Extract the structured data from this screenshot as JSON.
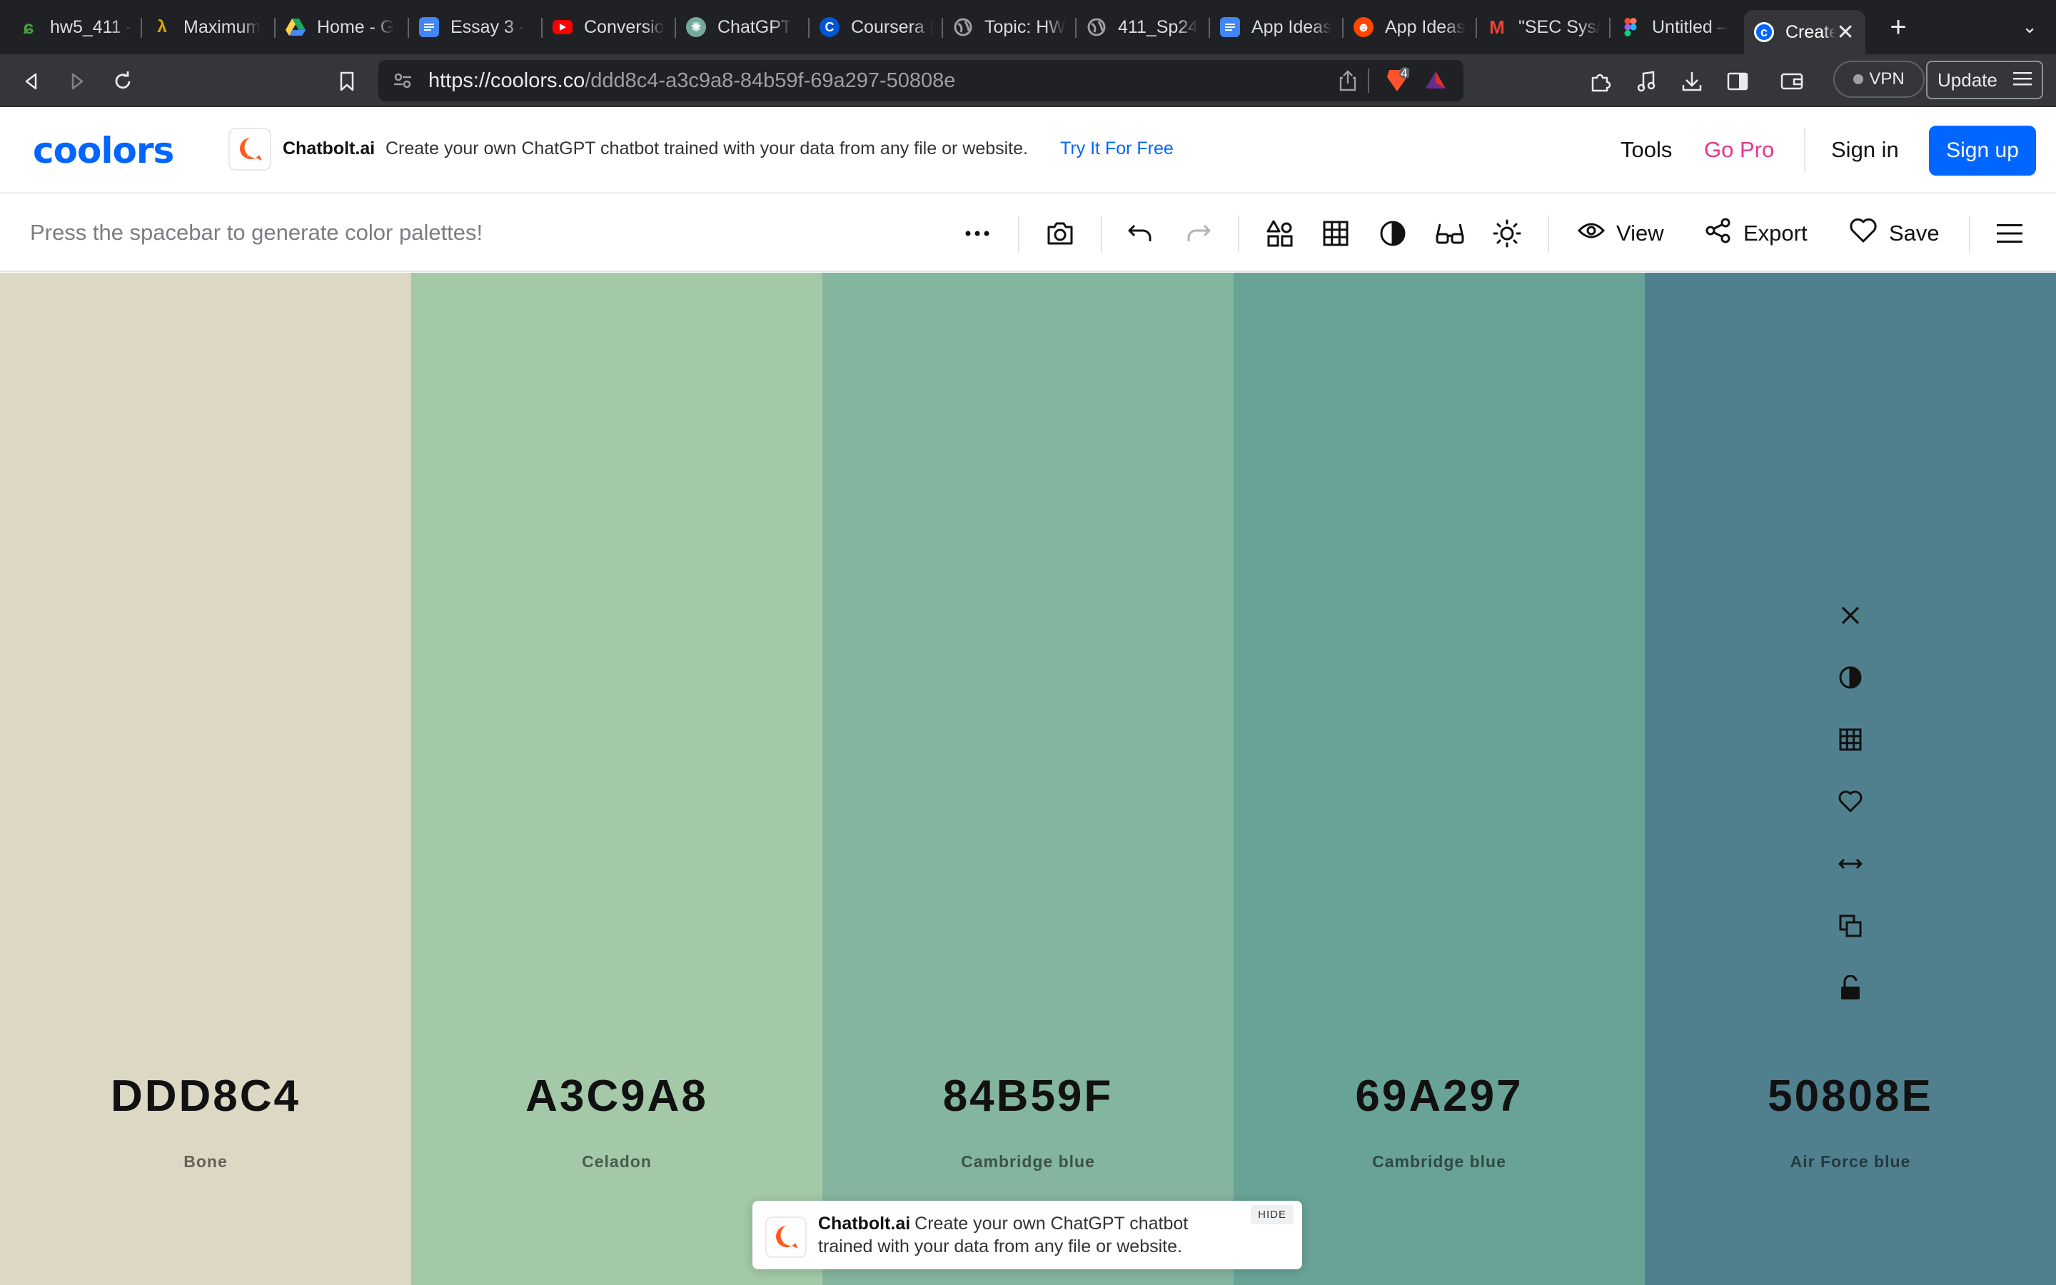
{
  "browser": {
    "tabs": [
      {
        "label": "hw5_411 -",
        "icon": "overleaf-icon",
        "color": "#47a141"
      },
      {
        "label": "Maximum",
        "icon": "python-icon",
        "color": "#e0a800"
      },
      {
        "label": "Home - G",
        "icon": "google-drive-icon",
        "color": "#1fa463"
      },
      {
        "label": "Essay 3 -",
        "icon": "google-docs-icon",
        "color": "#4285f4"
      },
      {
        "label": "Conversio",
        "icon": "youtube-icon",
        "color": "#ff0000"
      },
      {
        "label": "ChatGPT",
        "icon": "chatgpt-icon",
        "color": "#74aa9c"
      },
      {
        "label": "Coursera |",
        "icon": "coursera-icon",
        "color": "#0056d2"
      },
      {
        "label": "Topic: HW",
        "icon": "globe-icon",
        "color": "#9aa0a6"
      },
      {
        "label": "411_Sp24",
        "icon": "globe-icon",
        "color": "#9aa0a6"
      },
      {
        "label": "App Ideas",
        "icon": "google-docs-icon",
        "color": "#4285f4"
      },
      {
        "label": "App Ideas",
        "icon": "reddit-icon",
        "color": "#ff4500"
      },
      {
        "label": "\"SEC Sys/",
        "icon": "gmail-icon",
        "color": "#ea4335"
      },
      {
        "label": "Untitled –",
        "icon": "figma-icon",
        "color": "#a259ff"
      }
    ],
    "active_tab": {
      "label": "Create",
      "icon": "coolors-icon",
      "color": "#0066ff"
    },
    "url_host": "https://coolors.co",
    "url_path": "/ddd8c4-a3c9a8-84b59f-69a297-50808e",
    "brave_badge": "4",
    "vpn_label": "VPN",
    "update_label": "Update"
  },
  "site": {
    "logo": "coolors",
    "ad": {
      "brand": "Chatbolt.ai",
      "text": "Create your own ChatGPT chatbot trained with your data from any file or website.",
      "link": "Try It For Free"
    },
    "nav": {
      "tools": "Tools",
      "gopro": "Go Pro",
      "signin": "Sign in",
      "signup": "Sign up"
    }
  },
  "toolbar": {
    "hint": "Press the spacebar to generate color palettes!",
    "view": "View",
    "export": "Export",
    "save": "Save"
  },
  "palette": [
    {
      "hex": "DDD8C4",
      "name": "Bone",
      "color": "#DDD8C4"
    },
    {
      "hex": "A3C9A8",
      "name": "Celadon",
      "color": "#A3C9A8"
    },
    {
      "hex": "84B59F",
      "name": "Cambridge blue",
      "color": "#84B59F"
    },
    {
      "hex": "69A297",
      "name": "Cambridge blue",
      "color": "#69A297"
    },
    {
      "hex": "50808E",
      "name": "Air Force blue",
      "color": "#50808E"
    }
  ],
  "bottom_ad": {
    "brand": "Chatbolt.ai",
    "text": "Create your own ChatGPT chatbot trained with your data from any file or website.",
    "hide": "HIDE"
  }
}
